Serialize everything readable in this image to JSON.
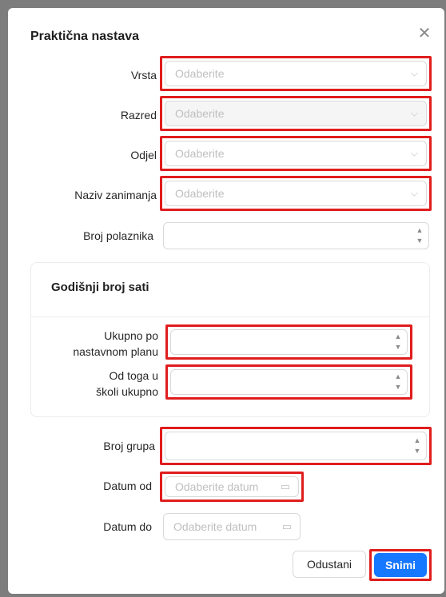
{
  "dialog": {
    "title": "Praktična nastava",
    "close_icon": "close-icon"
  },
  "fields": {
    "vrsta": {
      "label": "Vrsta",
      "placeholder": "Odaberite"
    },
    "razred": {
      "label": "Razred",
      "placeholder": "Odaberite",
      "disabled": true
    },
    "odjel": {
      "label": "Odjel",
      "placeholder": "Odaberite"
    },
    "naziv_zanimanja": {
      "label": "Naziv zanimanja",
      "placeholder": "Odaberite"
    },
    "broj_polaznika": {
      "label": "Broj polaznika",
      "value": ""
    }
  },
  "section": {
    "title": "Godišnji broj sati",
    "ukupno": {
      "label_line1": "Ukupno po",
      "label_line2": "nastavnom planu",
      "value": ""
    },
    "od_toga": {
      "label_line1": "Od toga u",
      "label_line2": "školi ukupno",
      "value": ""
    }
  },
  "broj_grupa": {
    "label": "Broj grupa",
    "value": ""
  },
  "datum_od": {
    "label": "Datum od",
    "placeholder": "Odaberite datum"
  },
  "datum_do": {
    "label": "Datum do",
    "placeholder": "Odaberite datum"
  },
  "footer": {
    "cancel_label": "Odustani",
    "save_label": "Snimi"
  },
  "colors": {
    "highlight": "#e01d1d",
    "primary": "#1677ff"
  }
}
